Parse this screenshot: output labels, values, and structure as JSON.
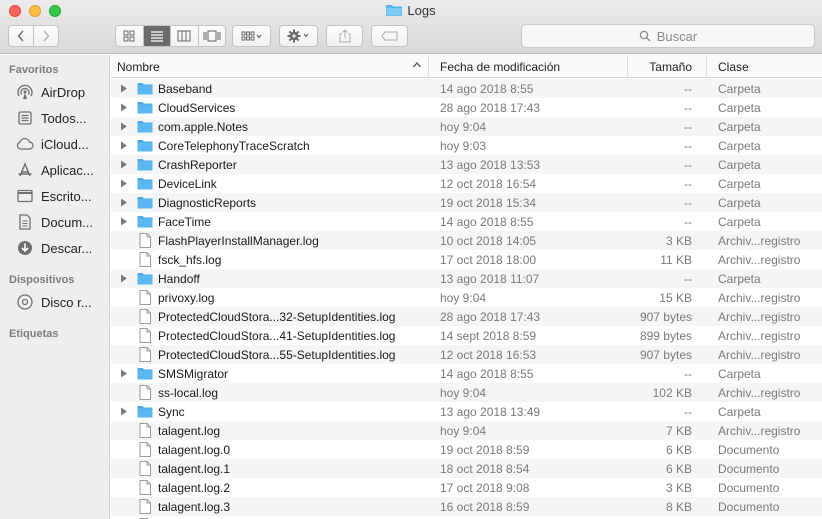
{
  "window": {
    "title": "Logs"
  },
  "toolbar": {
    "back_icon": "chevron-left-icon",
    "forward_icon": "chevron-right-icon",
    "view_modes": [
      "icon-view-icon",
      "list-view-icon",
      "column-view-icon",
      "coverflow-view-icon"
    ],
    "active_view": "list-view-icon",
    "arrange_icon": "grid-arrange-icon",
    "action_icon": "gear-icon",
    "share_icon": "share-icon",
    "tag_icon": "tag-icon",
    "search_placeholder": "Buscar"
  },
  "sidebar": {
    "sections": [
      {
        "title": "Favoritos",
        "items": [
          {
            "label": "AirDrop",
            "icon": "airdrop-icon"
          },
          {
            "label": "Todos...",
            "icon": "all-files-icon"
          },
          {
            "label": "iCloud...",
            "icon": "cloud-icon"
          },
          {
            "label": "Aplicac...",
            "icon": "applications-icon"
          },
          {
            "label": "Escrito...",
            "icon": "desktop-icon"
          },
          {
            "label": "Docum...",
            "icon": "document-icon"
          },
          {
            "label": "Descar...",
            "icon": "download-icon"
          }
        ]
      },
      {
        "title": "Dispositivos",
        "items": [
          {
            "label": "Disco r...",
            "icon": "disk-icon"
          }
        ]
      },
      {
        "title": "Etiquetas",
        "items": []
      }
    ]
  },
  "columns": {
    "name": "Nombre",
    "date": "Fecha de modificación",
    "size": "Tamaño",
    "kind": "Clase"
  },
  "colors": {
    "folder": "#5ab7f0",
    "selection_view": "#6b6b6b"
  },
  "files": [
    {
      "name": "Baseband",
      "date": "14 ago 2018 8:55",
      "size": "--",
      "kind": "Carpeta",
      "type": "folder"
    },
    {
      "name": "CloudServices",
      "date": "28 ago 2018 17:43",
      "size": "--",
      "kind": "Carpeta",
      "type": "folder"
    },
    {
      "name": "com.apple.Notes",
      "date": "hoy 9:04",
      "size": "--",
      "kind": "Carpeta",
      "type": "folder"
    },
    {
      "name": "CoreTelephonyTraceScratch",
      "date": "hoy 9:03",
      "size": "--",
      "kind": "Carpeta",
      "type": "folder"
    },
    {
      "name": "CrashReporter",
      "date": "13 ago 2018 13:53",
      "size": "--",
      "kind": "Carpeta",
      "type": "folder"
    },
    {
      "name": "DeviceLink",
      "date": "12 oct 2018 16:54",
      "size": "--",
      "kind": "Carpeta",
      "type": "folder"
    },
    {
      "name": "DiagnosticReports",
      "date": "19 oct 2018 15:34",
      "size": "--",
      "kind": "Carpeta",
      "type": "folder"
    },
    {
      "name": "FaceTime",
      "date": "14 ago 2018 8:55",
      "size": "--",
      "kind": "Carpeta",
      "type": "folder"
    },
    {
      "name": "FlashPlayerInstallManager.log",
      "date": "10 oct 2018 14:05",
      "size": "3 KB",
      "kind": "Archiv...registro",
      "type": "file"
    },
    {
      "name": "fsck_hfs.log",
      "date": "17 oct 2018 18:00",
      "size": "11 KB",
      "kind": "Archiv...registro",
      "type": "file"
    },
    {
      "name": "Handoff",
      "date": "13 ago 2018 11:07",
      "size": "--",
      "kind": "Carpeta",
      "type": "folder"
    },
    {
      "name": "privoxy.log",
      "date": "hoy 9:04",
      "size": "15 KB",
      "kind": "Archiv...registro",
      "type": "file"
    },
    {
      "name": "ProtectedCloudStora...32-SetupIdentities.log",
      "date": "28 ago 2018 17:43",
      "size": "907 bytes",
      "kind": "Archiv...registro",
      "type": "file"
    },
    {
      "name": "ProtectedCloudStora...41-SetupIdentities.log",
      "date": "14 sept 2018 8:59",
      "size": "899 bytes",
      "kind": "Archiv...registro",
      "type": "file"
    },
    {
      "name": "ProtectedCloudStora...55-SetupIdentities.log",
      "date": "12 oct 2018 16:53",
      "size": "907 bytes",
      "kind": "Archiv...registro",
      "type": "file"
    },
    {
      "name": "SMSMigrator",
      "date": "14 ago 2018 8:55",
      "size": "--",
      "kind": "Carpeta",
      "type": "folder"
    },
    {
      "name": "ss-local.log",
      "date": "hoy 9:04",
      "size": "102 KB",
      "kind": "Archiv...registro",
      "type": "file"
    },
    {
      "name": "Sync",
      "date": "13 ago 2018 13:49",
      "size": "--",
      "kind": "Carpeta",
      "type": "folder"
    },
    {
      "name": "talagent.log",
      "date": "hoy 9:04",
      "size": "7 KB",
      "kind": "Archiv...registro",
      "type": "file"
    },
    {
      "name": "talagent.log.0",
      "date": "19 oct 2018 8:59",
      "size": "6 KB",
      "kind": "Documento",
      "type": "file"
    },
    {
      "name": "talagent.log.1",
      "date": "18 oct 2018 8:54",
      "size": "6 KB",
      "kind": "Documento",
      "type": "file"
    },
    {
      "name": "talagent.log.2",
      "date": "17 oct 2018 9:08",
      "size": "3 KB",
      "kind": "Documento",
      "type": "file"
    },
    {
      "name": "talagent.log.3",
      "date": "16 oct 2018 8:59",
      "size": "8 KB",
      "kind": "Documento",
      "type": "file"
    },
    {
      "name": "",
      "date": "",
      "size": "",
      "kind": "",
      "type": "file"
    }
  ]
}
